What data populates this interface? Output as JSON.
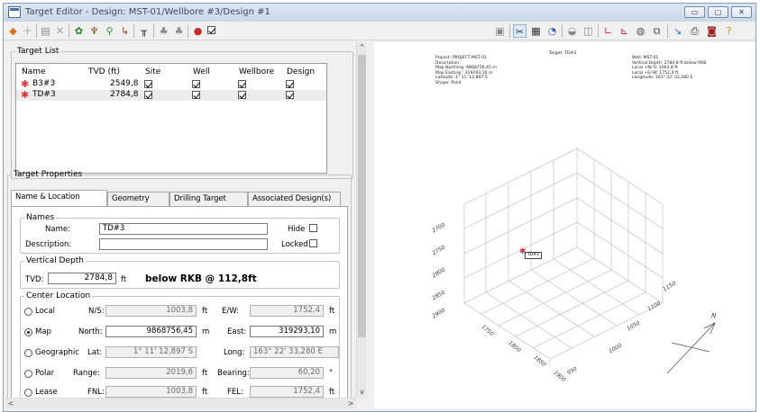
{
  "window": {
    "title": "Target Editor - Design: MST-01/Wellbore #3/Design #1",
    "controls": {
      "minimize": "▭",
      "maximize": "▢",
      "close": "✕"
    }
  },
  "target_list": {
    "legend": "Target List",
    "columns": [
      "Name",
      "TVD (ft)",
      "Site",
      "Well",
      "Wellbore",
      "Design"
    ],
    "rows": [
      {
        "name": "B3#3",
        "tvd": "2549,8",
        "site": true,
        "well": true,
        "wellbore": true,
        "design": true
      },
      {
        "name": "TD#3",
        "tvd": "2784,8",
        "site": true,
        "well": true,
        "wellbore": true,
        "design": true
      }
    ]
  },
  "target_properties": {
    "legend": "Target Properties",
    "tabs": [
      "Name & Location",
      "Geometry",
      "Drilling Target",
      "Associated Design(s)"
    ],
    "names": {
      "legend": "Names",
      "name_label": "Name:",
      "name_value": "TD#3",
      "description_label": "Description:",
      "description_value": "",
      "hide_label": "Hide",
      "locked_label": "Locked"
    },
    "vertical_depth": {
      "legend": "Vertical Depth",
      "tvd_label": "TVD:",
      "tvd_value": "2784,8",
      "unit": "ft",
      "reference": "below RKB @ 112,8ft"
    },
    "center_location": {
      "legend": "Center Location",
      "selected": "Map",
      "rows": [
        {
          "option": "Local",
          "l1": "N/S:",
          "v1": "1003,8",
          "u1": "ft",
          "l2": "E/W:",
          "v2": "1752,4",
          "u2": "ft"
        },
        {
          "option": "Map",
          "l1": "North:",
          "v1": "9868756,45",
          "u1": "m",
          "l2": "East:",
          "v2": "319293,10",
          "u2": "m"
        },
        {
          "option": "Geographic",
          "l1": "Lat:",
          "v1": "1° 11' 12,897 S",
          "u1": "",
          "l2": "Long:",
          "v2": "163° 22' 33,280 E",
          "u2": ""
        },
        {
          "option": "Polar",
          "l1": "Range:",
          "v1": "2019,6",
          "u1": "ft",
          "l2": "Bearing:",
          "v2": "60,20",
          "u2": "°"
        },
        {
          "option": "Lease",
          "l1": "FNL:",
          "v1": "1003,8",
          "u1": "ft",
          "l2": "FEL:",
          "v2": "1752,4",
          "u2": "ft"
        }
      ]
    }
  },
  "plot": {
    "title": "Target: TD#3",
    "info_left": [
      "Project: PROJECT MST-01",
      "Description:",
      "Map Northing: 9868756,45 m",
      "Map Easting : 319293,10 m",
      "Latitude: 1° 11' 12,897 S",
      "Shape: Point"
    ],
    "info_right": [
      "Well: MST-01",
      "Vertical Depth: 2784,8 ft below RKB",
      "Local +N/-S: 1003,8 ft",
      "Local +E/-W: 1752,4 ft",
      "Longitude: 163° 22' 33,280 E"
    ],
    "target_label": "TD#3",
    "depth_ticks": [
      "2700",
      "2750",
      "2800",
      "2850",
      "2900"
    ],
    "x_ticks": [
      "1750",
      "1800",
      "1850",
      "1900"
    ],
    "y_ticks": [
      "950",
      "1000",
      "1050",
      "1100",
      "1150"
    ],
    "north_label": "N"
  },
  "icons": [
    "new-target-icon",
    "add-icon",
    "save-icon",
    "delete-icon",
    "target-icon",
    "tree-icon",
    "pin-icon",
    "chart-icon",
    "tool-icon",
    "stack-icon",
    "layers-icon",
    "ring-icon",
    "check-icon",
    "copy-icon",
    "view-icon",
    "grid-icon",
    "color-icon",
    "filter-icon",
    "frame-icon",
    "plot2d-icon",
    "plot3d-icon",
    "globe-icon",
    "print-setup-icon",
    "export-icon",
    "print-icon",
    "camera-icon",
    "help-icon"
  ]
}
